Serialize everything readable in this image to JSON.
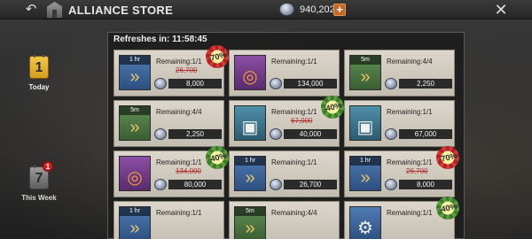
{
  "header": {
    "title": "ALLIANCE STORE",
    "currency_amount": "940,202",
    "back_icon": "back-arrow-icon",
    "close_icon": "close-icon"
  },
  "tabs": [
    {
      "label": "Today",
      "day": "1",
      "active": true
    },
    {
      "label": "This Week",
      "day": "7",
      "badge": "1",
      "active": false
    }
  ],
  "refresh": {
    "text": "Refreshes in: 11:58:45"
  },
  "items": [
    {
      "duration": "1 hr",
      "rarity": "blue",
      "icon": "speedup-chevron-icon",
      "remaining": "Remaining:1/1",
      "original_price": "26,700",
      "price": "8,000",
      "discount": "-70%",
      "discount_color": "red"
    },
    {
      "duration": "",
      "rarity": "purple",
      "icon": "armor-piece-icon",
      "remaining": "Remaining:1/1",
      "original_price": "",
      "price": "134,000",
      "discount": "",
      "discount_color": ""
    },
    {
      "duration": "5m",
      "rarity": "green",
      "icon": "speedup-chevron-icon",
      "remaining": "Remaining:4/4",
      "original_price": "",
      "price": "2,250",
      "discount": "",
      "discount_color": ""
    },
    {
      "duration": "5m",
      "rarity": "green",
      "icon": "speedup-chevron-icon",
      "remaining": "Remaining:4/4",
      "original_price": "",
      "price": "2,250",
      "discount": "",
      "discount_color": ""
    },
    {
      "duration": "",
      "rarity": "teal",
      "icon": "building-icon",
      "remaining": "Remaining:1/1",
      "original_price": "67,000",
      "price": "40,000",
      "discount": "-40%",
      "discount_color": "green"
    },
    {
      "duration": "",
      "rarity": "teal",
      "icon": "building-icon",
      "remaining": "Remaining:1/1",
      "original_price": "",
      "price": "67,000",
      "discount": "",
      "discount_color": ""
    },
    {
      "duration": "",
      "rarity": "purple",
      "icon": "armor-piece-icon",
      "remaining": "Remaining:1/1",
      "original_price": "134,000",
      "price": "80,000",
      "discount": "-40%",
      "discount_color": "green"
    },
    {
      "duration": "1 hr",
      "rarity": "blue",
      "icon": "speedup-chevron-icon",
      "remaining": "Remaining:1/1",
      "original_price": "",
      "price": "26,700",
      "discount": "",
      "discount_color": ""
    },
    {
      "duration": "1 hr",
      "rarity": "blue",
      "icon": "speedup-chevron-icon",
      "remaining": "Remaining:1/1",
      "original_price": "26,700",
      "price": "8,000",
      "discount": "-70%",
      "discount_color": "red"
    },
    {
      "duration": "1 hr",
      "rarity": "blue",
      "icon": "speedup-chevron-icon",
      "remaining": "Remaining:1/1",
      "original_price": "",
      "price": "",
      "discount": "",
      "discount_color": ""
    },
    {
      "duration": "5m",
      "rarity": "green",
      "icon": "speedup-chevron-icon",
      "remaining": "Remaining:4/4",
      "original_price": "",
      "price": "",
      "discount": "",
      "discount_color": ""
    },
    {
      "duration": "",
      "rarity": "blue",
      "icon": "mech-unit-icon",
      "remaining": "Remaining:1/1",
      "original_price": "",
      "price": "",
      "discount": "-40%",
      "discount_color": "green"
    }
  ]
}
